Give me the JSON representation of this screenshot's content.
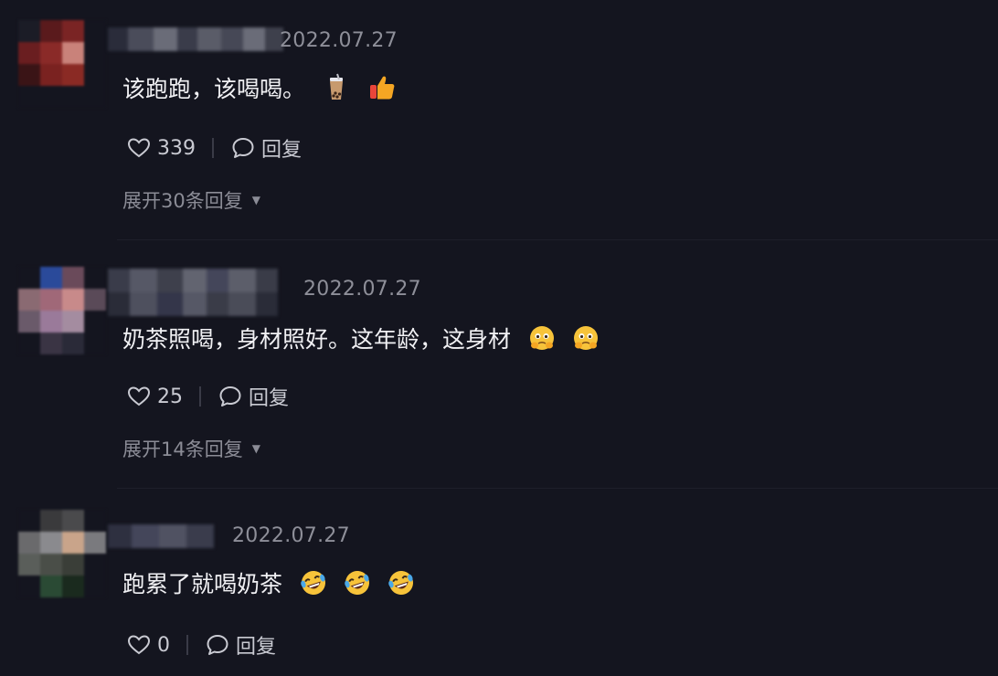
{
  "comments": [
    {
      "date": "2022.07.27",
      "text": "该跑跑，该喝喝。",
      "emojis": [
        "bubble-tea-emoji",
        "thumbs-up-emoji"
      ],
      "likes": "339",
      "reply_label": "回复",
      "expand_label": "展开30条回复"
    },
    {
      "date": "2022.07.27",
      "text": "奶茶照喝，身材照好。这年龄，这身材",
      "emojis": [
        "pleading-face-emoji",
        "pleading-face-emoji"
      ],
      "likes": "25",
      "reply_label": "回复",
      "expand_label": "展开14条回复"
    },
    {
      "date": "2022.07.27",
      "text": "跑累了就喝奶茶",
      "emojis": [
        "rolling-laughing-emoji",
        "rolling-laughing-emoji",
        "rolling-laughing-emoji"
      ],
      "likes": "0",
      "reply_label": "回复"
    }
  ],
  "colors": {
    "background": "#14151f",
    "text": "#f1f1f4",
    "muted": "#8e8f99"
  }
}
